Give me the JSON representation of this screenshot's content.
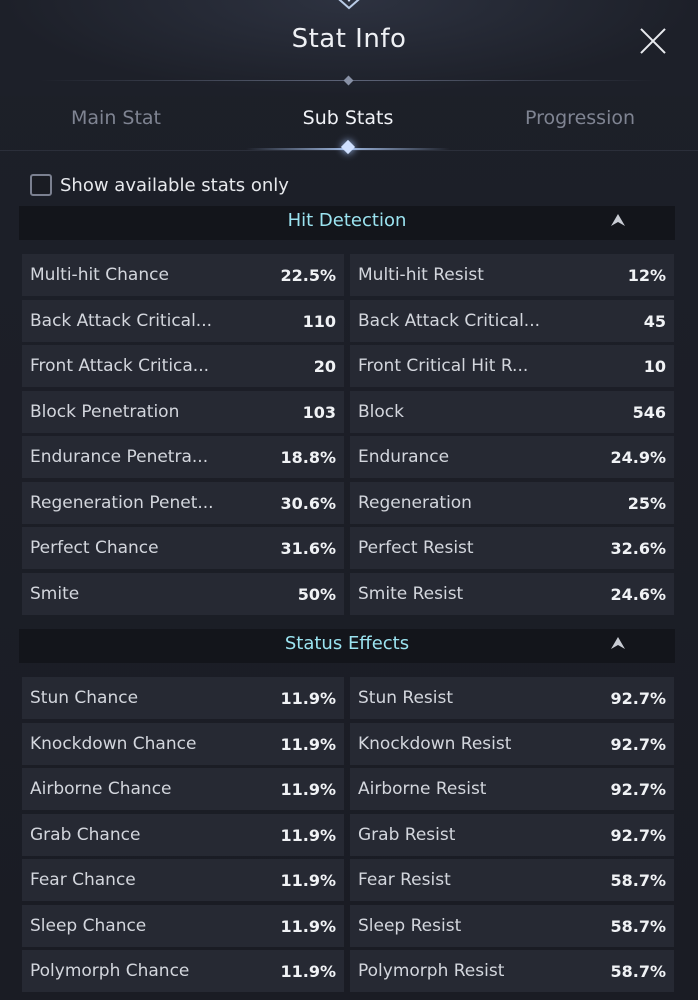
{
  "window": {
    "title": "Stat Info"
  },
  "tabs": [
    {
      "label": "Main Stat"
    },
    {
      "label": "Sub Stats"
    },
    {
      "label": "Progression"
    }
  ],
  "filter": {
    "label": "Show available stats only"
  },
  "sections": [
    {
      "title": "Hit Detection",
      "rows": [
        {
          "left": {
            "name": "Multi-hit Chance",
            "value": "22.5%"
          },
          "right": {
            "name": "Multi-hit Resist",
            "value": "12%"
          }
        },
        {
          "left": {
            "name": "Back Attack Critical...",
            "value": "110"
          },
          "right": {
            "name": "Back Attack Critical...",
            "value": "45"
          }
        },
        {
          "left": {
            "name": "Front Attack Critica...",
            "value": "20"
          },
          "right": {
            "name": "Front Critical Hit R...",
            "value": "10"
          }
        },
        {
          "left": {
            "name": "Block Penetration",
            "value": "103"
          },
          "right": {
            "name": "Block",
            "value": "546"
          }
        },
        {
          "left": {
            "name": "Endurance Penetra...",
            "value": "18.8%"
          },
          "right": {
            "name": "Endurance",
            "value": "24.9%"
          }
        },
        {
          "left": {
            "name": "Regeneration Penet...",
            "value": "30.6%"
          },
          "right": {
            "name": "Regeneration",
            "value": "25%"
          }
        },
        {
          "left": {
            "name": "Perfect Chance",
            "value": "31.6%"
          },
          "right": {
            "name": "Perfect Resist",
            "value": "32.6%"
          }
        },
        {
          "left": {
            "name": "Smite",
            "value": "50%"
          },
          "right": {
            "name": "Smite Resist",
            "value": "24.6%"
          }
        }
      ]
    },
    {
      "title": "Status Effects",
      "rows": [
        {
          "left": {
            "name": "Stun Chance",
            "value": "11.9%"
          },
          "right": {
            "name": "Stun Resist",
            "value": "92.7%"
          }
        },
        {
          "left": {
            "name": "Knockdown Chance",
            "value": "11.9%"
          },
          "right": {
            "name": "Knockdown Resist",
            "value": "92.7%"
          }
        },
        {
          "left": {
            "name": "Airborne Chance",
            "value": "11.9%"
          },
          "right": {
            "name": "Airborne Resist",
            "value": "92.7%"
          }
        },
        {
          "left": {
            "name": "Grab Chance",
            "value": "11.9%"
          },
          "right": {
            "name": "Grab Resist",
            "value": "92.7%"
          }
        },
        {
          "left": {
            "name": "Fear Chance",
            "value": "11.9%"
          },
          "right": {
            "name": "Fear Resist",
            "value": "58.7%"
          }
        },
        {
          "left": {
            "name": "Sleep Chance",
            "value": "11.9%"
          },
          "right": {
            "name": "Sleep Resist",
            "value": "58.7%"
          }
        },
        {
          "left": {
            "name": "Polymorph Chance",
            "value": "11.9%"
          },
          "right": {
            "name": "Polymorph Resist",
            "value": "58.7%"
          }
        }
      ]
    }
  ],
  "colors": {
    "section_title": "#9be3f0",
    "panel_bg": "#1d2029",
    "cell_bg": "#262933"
  },
  "icons": {
    "close": "close-icon",
    "collapse": "chevron-up-icon"
  }
}
